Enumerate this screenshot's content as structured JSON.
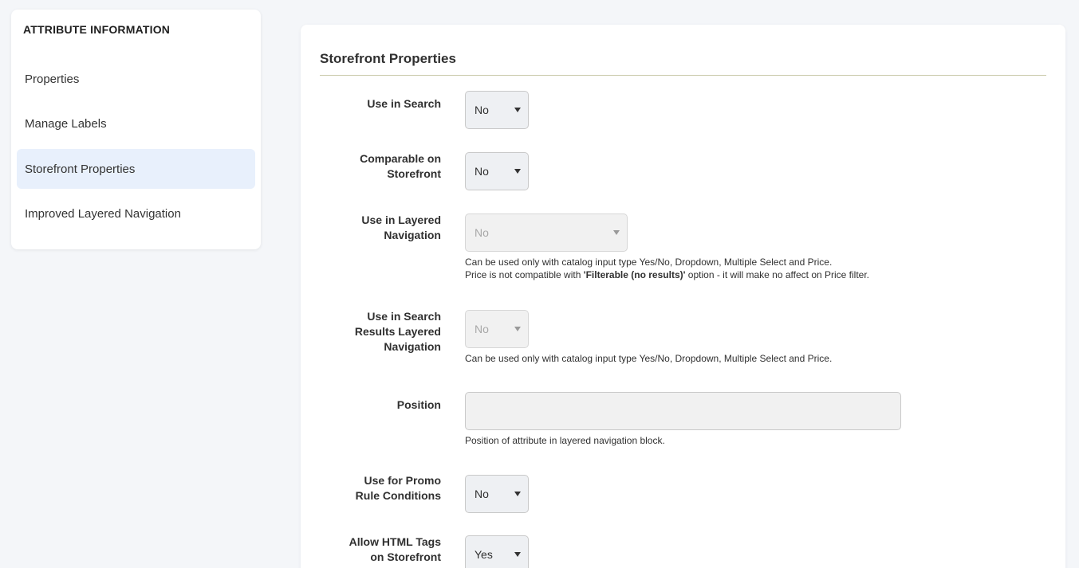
{
  "sidebar": {
    "title": "ATTRIBUTE INFORMATION",
    "items": [
      {
        "label": "Properties",
        "active": false
      },
      {
        "label": "Manage Labels",
        "active": false
      },
      {
        "label": "Storefront Properties",
        "active": true
      },
      {
        "label": "Improved Layered Navigation",
        "active": false
      }
    ]
  },
  "panel": {
    "title": "Storefront Properties",
    "fields": {
      "use_in_search": {
        "label": "Use in Search",
        "value": "No"
      },
      "comparable": {
        "label_line1": "Comparable on",
        "label_line2": "Storefront",
        "value": "No"
      },
      "layered_nav": {
        "label_line1": "Use in Layered",
        "label_line2": "Navigation",
        "value": "No",
        "note_line1": "Can be used only with catalog input type Yes/No, Dropdown, Multiple Select and Price.",
        "note_line2_pre": "Price is not compatible with ",
        "note_line2_bold": "'Filterable (no results)'",
        "note_line2_post": " option - it will make no affect on Price filter."
      },
      "search_layered_nav": {
        "label_line1": "Use in Search",
        "label_line2": "Results Layered",
        "label_line3": "Navigation",
        "value": "No",
        "note": "Can be used only with catalog input type Yes/No, Dropdown, Multiple Select and Price."
      },
      "position": {
        "label": "Position",
        "value": "",
        "note": "Position of attribute in layered navigation block."
      },
      "promo": {
        "label_line1": "Use for Promo",
        "label_line2": "Rule Conditions",
        "value": "No"
      },
      "html_tags": {
        "label_line1": "Allow HTML Tags",
        "label_line2": "on Storefront",
        "value": "Yes"
      }
    }
  },
  "colors": {
    "page_bg": "#f4f6f9",
    "active_item_bg": "#e8f0fc",
    "rule": "#c8c8a8"
  }
}
